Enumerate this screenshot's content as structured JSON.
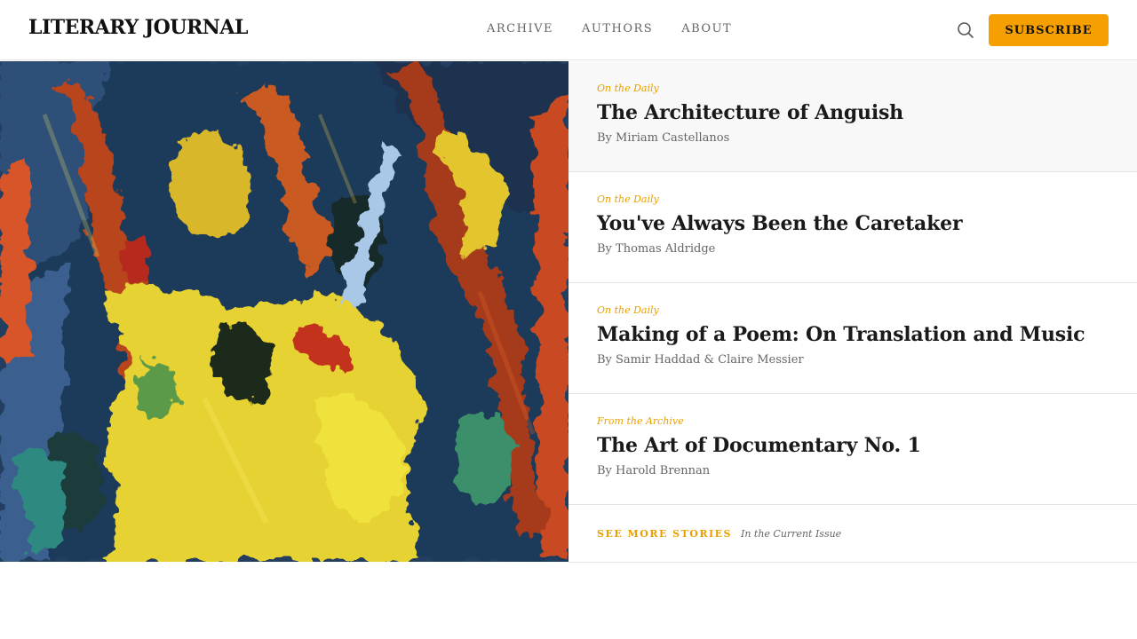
{
  "header": {
    "logo": "LITERARY JOURNAL",
    "nav": [
      "ARCHIVE",
      "AUTHORS",
      "ABOUT"
    ],
    "search_icon": "search-icon",
    "subscribe_label": "SUBSCRIBE",
    "accent_color": "#f5a000"
  },
  "stories": [
    {
      "kicker": "On the Daily",
      "title": "The Architecture of Anguish",
      "byline": "By Miriam Castellanos"
    },
    {
      "kicker": "On the Daily",
      "title": "You've Always Been the Caretaker",
      "byline": "By Thomas Aldridge"
    },
    {
      "kicker": "On the Daily",
      "title": "Making of a Poem: On Translation and Music",
      "byline": "By Samir Haddad & Claire Messier"
    },
    {
      "kicker": "From the Archive",
      "title": "The Art of Documentary No. 1",
      "byline": "By Harold Brennan"
    }
  ],
  "more": {
    "link": "SEE MORE STORIES",
    "note": "In the Current Issue"
  }
}
